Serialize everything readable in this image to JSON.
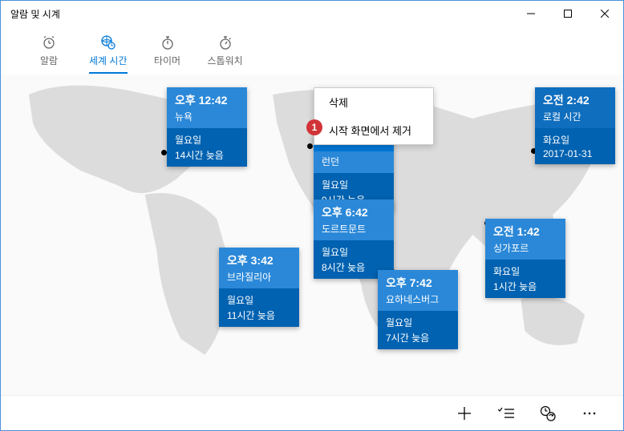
{
  "titlebar": {
    "title": "알람 및 시계"
  },
  "tabs": {
    "alarm": "알람",
    "worldclock": "세계 시간",
    "timer": "타이머",
    "stopwatch": "스톱워치"
  },
  "contextMenu": {
    "delete": "삭제",
    "unpin": "시작 화면에서 제거"
  },
  "badge": "1",
  "clocks": {
    "newyork": {
      "time": "오후 12:42",
      "city": "뉴욕",
      "day": "월요일",
      "offset": "14시간 늦음"
    },
    "london": {
      "time": "",
      "city": "런던",
      "day": "월요일",
      "offset": "9시간 늦음"
    },
    "dortmund": {
      "time": "오후 6:42",
      "city": "도르트문트",
      "day": "월요일",
      "offset": "8시간 늦음"
    },
    "brasilia": {
      "time": "오후 3:42",
      "city": "브라질리아",
      "day": "월요일",
      "offset": "11시간 늦음"
    },
    "johannesburg": {
      "time": "오후 7:42",
      "city": "요하네스버그",
      "day": "월요일",
      "offset": "7시간 늦음"
    },
    "singapore": {
      "time": "오전 1:42",
      "city": "싱가포르",
      "day": "화요일",
      "offset": "1시간 늦음"
    },
    "local": {
      "time": "오전 2:42",
      "city": "로컬 시간",
      "day": "화요일",
      "offset": "2017-01-31"
    }
  }
}
